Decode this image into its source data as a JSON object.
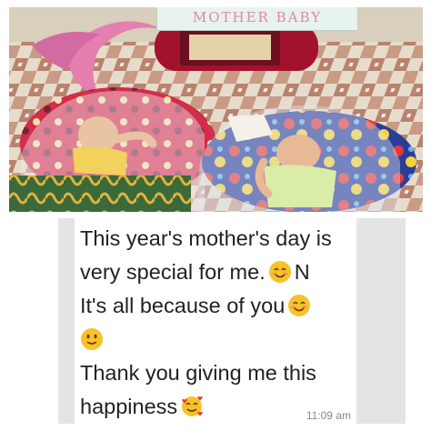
{
  "photo": {
    "banner_text": "MOTHER BABY"
  },
  "message": {
    "line1": "This year's mother's day is",
    "line2_text": "very special for me.",
    "line2_suffix": "N",
    "line3_text": "It's all because of you",
    "line5_text": "Thank you giving me this",
    "line6_text": "happiness",
    "emojis": [
      "smiling-face-with-smiling-eyes-icon",
      "smiling-face-with-smiling-eyes-icon",
      "slightly-smiling-face-icon",
      "smiling-face-with-hearts-icon"
    ],
    "timestamp": "11:09 am"
  },
  "colors": {
    "bubble": "#ffffff",
    "sidebar": "#e4e4e4",
    "text": "#222222",
    "timestamp": "#8a8a8a",
    "emoji_yellow": "#f7c22a"
  }
}
